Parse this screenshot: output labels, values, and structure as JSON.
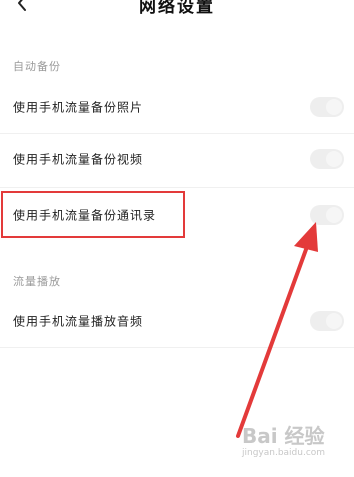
{
  "header": {
    "title": "网络设置",
    "back_icon": "chevron-left-icon"
  },
  "sections": [
    {
      "label": "自动备份",
      "items": [
        {
          "label": "使用手机流量备份照片",
          "toggle_on": false
        },
        {
          "label": "使用手机流量备份视频",
          "toggle_on": false
        },
        {
          "label": "使用手机流量备份通讯录",
          "toggle_on": false,
          "highlighted": true
        }
      ]
    },
    {
      "label": "流量播放",
      "items": [
        {
          "label": "使用手机流量播放音频",
          "toggle_on": false
        }
      ]
    }
  ],
  "watermark": {
    "brand": "Bai 经验",
    "site": "jingyan.baidu.com"
  },
  "colors": {
    "highlight": "#e33a3a",
    "toggle_off": "#eeeeee",
    "section_label": "#9a9a9a"
  }
}
